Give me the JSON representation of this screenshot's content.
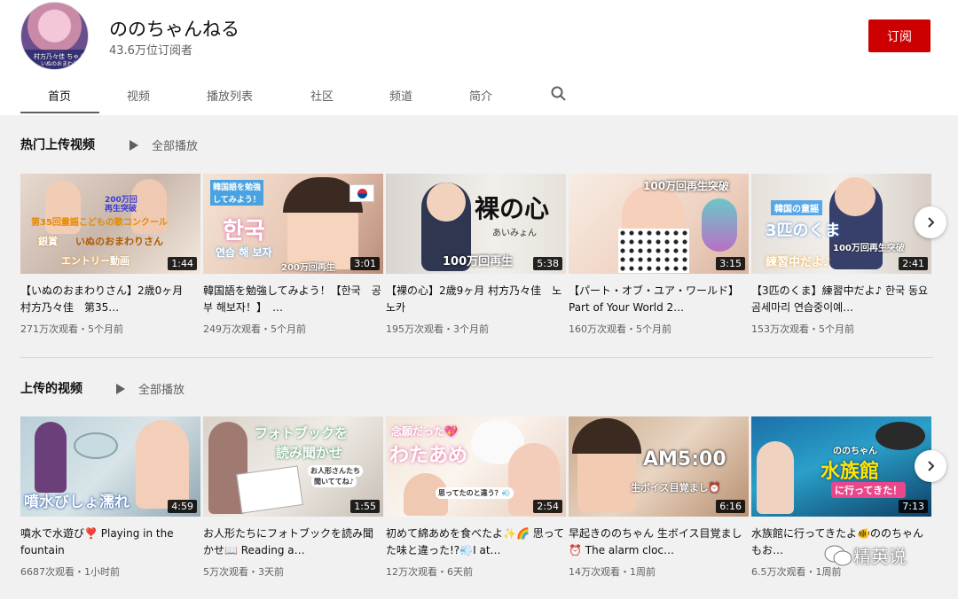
{
  "channel": {
    "name": "ののちゃんねる",
    "subscribers": "43.6万位订阅者",
    "subscribe_label": "订阅",
    "avatar_caption": "村方乃々佳 ちゃん",
    "avatar_caption2": "いぬのおまわり"
  },
  "tabs": [
    {
      "label": "首页",
      "active": true
    },
    {
      "label": "视频"
    },
    {
      "label": "播放列表"
    },
    {
      "label": "社区"
    },
    {
      "label": "频道"
    },
    {
      "label": "简介"
    }
  ],
  "search_icon": "search-icon",
  "shelves": [
    {
      "title": "热门上传视频",
      "play_all": "全部播放",
      "videos": [
        {
          "title": "【いぬのおまわりさん】2歳0ヶ月　村方乃々佳　第35…",
          "meta": "271万次观看・5个月前",
          "duration": "1:44",
          "overlay": [
            "200万回",
            "再生突破",
            "第35回童謡こどもの歌コンクール",
            "銀賞",
            "いぬのおまわりさん",
            "エントリー動画"
          ]
        },
        {
          "title": "韓国語を勉強してみよう！【한국　공부 해보자！】　…",
          "meta": "249万次观看・5个月前",
          "duration": "3:01",
          "overlay": [
            "韓国語を勉強",
            "してみよう！",
            "한국",
            "연습 해 보자",
            "200万回再生"
          ]
        },
        {
          "title": "【裸の心】2歳9ヶ月 村方乃々佳　노노카",
          "meta": "195万次观看・3个月前",
          "duration": "5:38",
          "overlay": [
            "裸の心",
            "あいみょん",
            "100万回再生"
          ]
        },
        {
          "title": "【パート・オブ・ユア・ワールド】Part of Your World 2…",
          "meta": "160万次观看・5个月前",
          "duration": "3:15",
          "overlay": [
            "100万回再生突破"
          ]
        },
        {
          "title": "【3匹のくま】練習中だよ♪ 한국 동요 곰세마리 연습중이예…",
          "meta": "153万次观看・5个月前",
          "duration": "2:41",
          "overlay": [
            "韓国の童謡",
            "3匹のくま",
            "100万回再生突破",
            "練習中だよ♪"
          ]
        }
      ]
    },
    {
      "title": "上传的视频",
      "play_all": "全部播放",
      "videos": [
        {
          "title": "噴水で水遊び❣️ Playing in the fountain",
          "meta": "6687次观看・1小时前",
          "duration": "4:59",
          "overlay": [
            "噴水びしょ濡れ"
          ]
        },
        {
          "title": "お人形たちにフォトブックを読み聞かせ📖 Reading a…",
          "meta": "5万次观看・3天前",
          "duration": "1:55",
          "overlay": [
            "フォトブックを",
            "読み聞かせ",
            "お人形さんたち",
            "聞いててね♪"
          ]
        },
        {
          "title": "初めて綿あめを食べたよ✨🌈 思ってた味と違った!?💨I at…",
          "meta": "12万次观看・6天前",
          "duration": "2:54",
          "overlay": [
            "念願だった💖",
            "わたあめ",
            "思ってたのと違う？💨"
          ]
        },
        {
          "title": "早起きののちゃん 生ボイス目覚まし⏰ The alarm cloc…",
          "meta": "14万次观看・1周前",
          "duration": "6:16",
          "overlay": [
            "AM5:00",
            "生ボイス目覚まし⏰"
          ]
        },
        {
          "title": "水族館に行ってきたよ🐠ののちゃんもお…",
          "meta": "6.5万次观看・1周前",
          "duration": "7:13",
          "overlay": [
            "ののちゃん",
            "水族館",
            "に行ってきた！"
          ]
        }
      ]
    }
  ],
  "watermark": "精英说",
  "colors": {
    "accent": "#cc0000",
    "background": "#f1f1f1",
    "header": "#ffffff",
    "secondary_text": "#606060"
  }
}
